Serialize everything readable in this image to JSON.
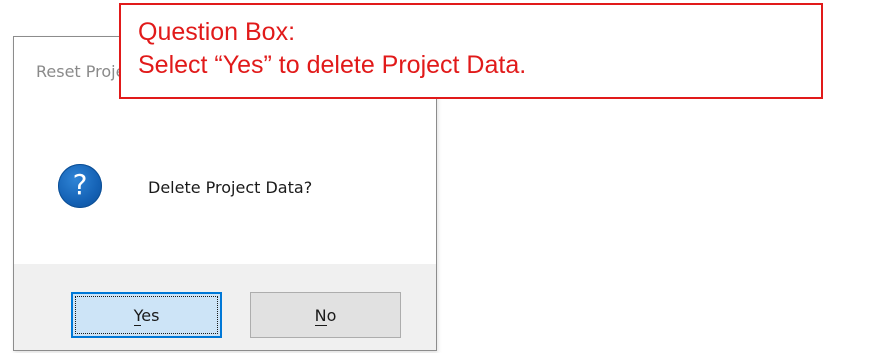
{
  "dialog": {
    "title": "Reset Project Data",
    "icon": "question-icon",
    "message": "Delete Project Data?",
    "buttons": {
      "yes": {
        "pre": "",
        "mnemonic": "Y",
        "post": "es"
      },
      "no": {
        "pre": "",
        "mnemonic": "N",
        "post": "o"
      }
    }
  },
  "callout": {
    "line1": "Question Box:",
    "line2": "Select “Yes” to delete Project Data.",
    "color": "#e11a1a"
  },
  "colors": {
    "default_button_border": "#0078d7",
    "default_button_fill": "#cde4f7",
    "footer_bg": "#f0f0f0",
    "icon_blue": "#1461b4"
  }
}
